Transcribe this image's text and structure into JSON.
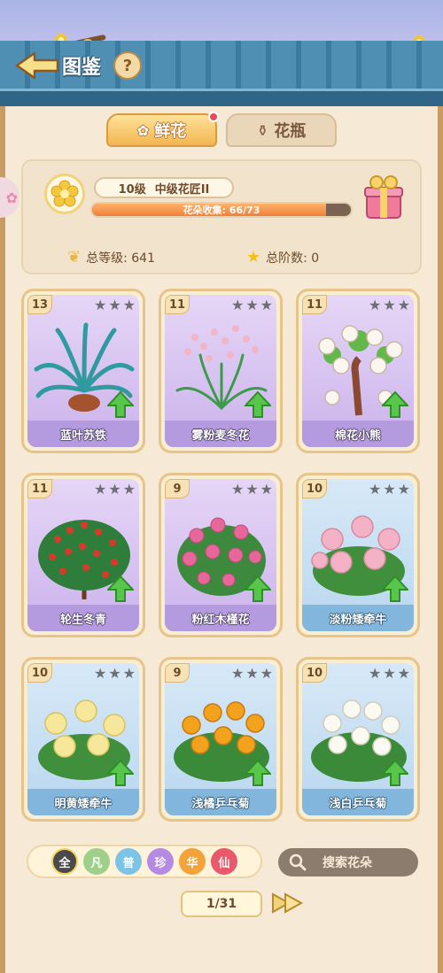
{
  "header": {
    "title": "图鉴",
    "help_label": "?"
  },
  "tabs": [
    {
      "label": "鲜花",
      "active": true,
      "icon": "flower-icon",
      "has_notification": true
    },
    {
      "label": "花瓶",
      "active": false,
      "icon": "vase-icon"
    }
  ],
  "summary": {
    "level": "10级",
    "rank_title": "中级花匠II",
    "progress_label": "花朵收集: 66/73",
    "progress_fraction": 0.904,
    "total_level": "总等级: 641",
    "total_stage": "总阶数: 0"
  },
  "cards": [
    {
      "level": "13",
      "name": "蓝叶苏铁",
      "theme": "purple",
      "plant": "fern"
    },
    {
      "level": "11",
      "name": "雾粉麦冬花",
      "theme": "purple",
      "plant": "grass"
    },
    {
      "level": "11",
      "name": "棉花小熊",
      "theme": "purple",
      "plant": "tree"
    },
    {
      "level": "11",
      "name": "轮生冬青",
      "theme": "purple",
      "plant": "holly"
    },
    {
      "level": "9",
      "name": "粉红木槿花",
      "theme": "purple",
      "plant": "hibiscus"
    },
    {
      "level": "10",
      "name": "淡粉矮牵牛",
      "theme": "blue",
      "plant": "pink-petunia"
    },
    {
      "level": "10",
      "name": "明黄矮牵牛",
      "theme": "blue",
      "plant": "yellow-petunia"
    },
    {
      "level": "9",
      "name": "浅橘乒乓菊",
      "theme": "blue",
      "plant": "orange-mum"
    },
    {
      "level": "10",
      "name": "浅白乒乓菊",
      "theme": "blue",
      "plant": "white-mum"
    }
  ],
  "filters": [
    {
      "label": "全",
      "color": "#4a4a4a"
    },
    {
      "label": "凡",
      "color": "#9ed08a"
    },
    {
      "label": "普",
      "color": "#7cc3e6"
    },
    {
      "label": "珍",
      "color": "#b48ae2"
    },
    {
      "label": "华",
      "color": "#f2a33a"
    },
    {
      "label": "仙",
      "color": "#e85a6b"
    }
  ],
  "search": {
    "label": "搜索花朵"
  },
  "pager": {
    "label": "1/31"
  }
}
